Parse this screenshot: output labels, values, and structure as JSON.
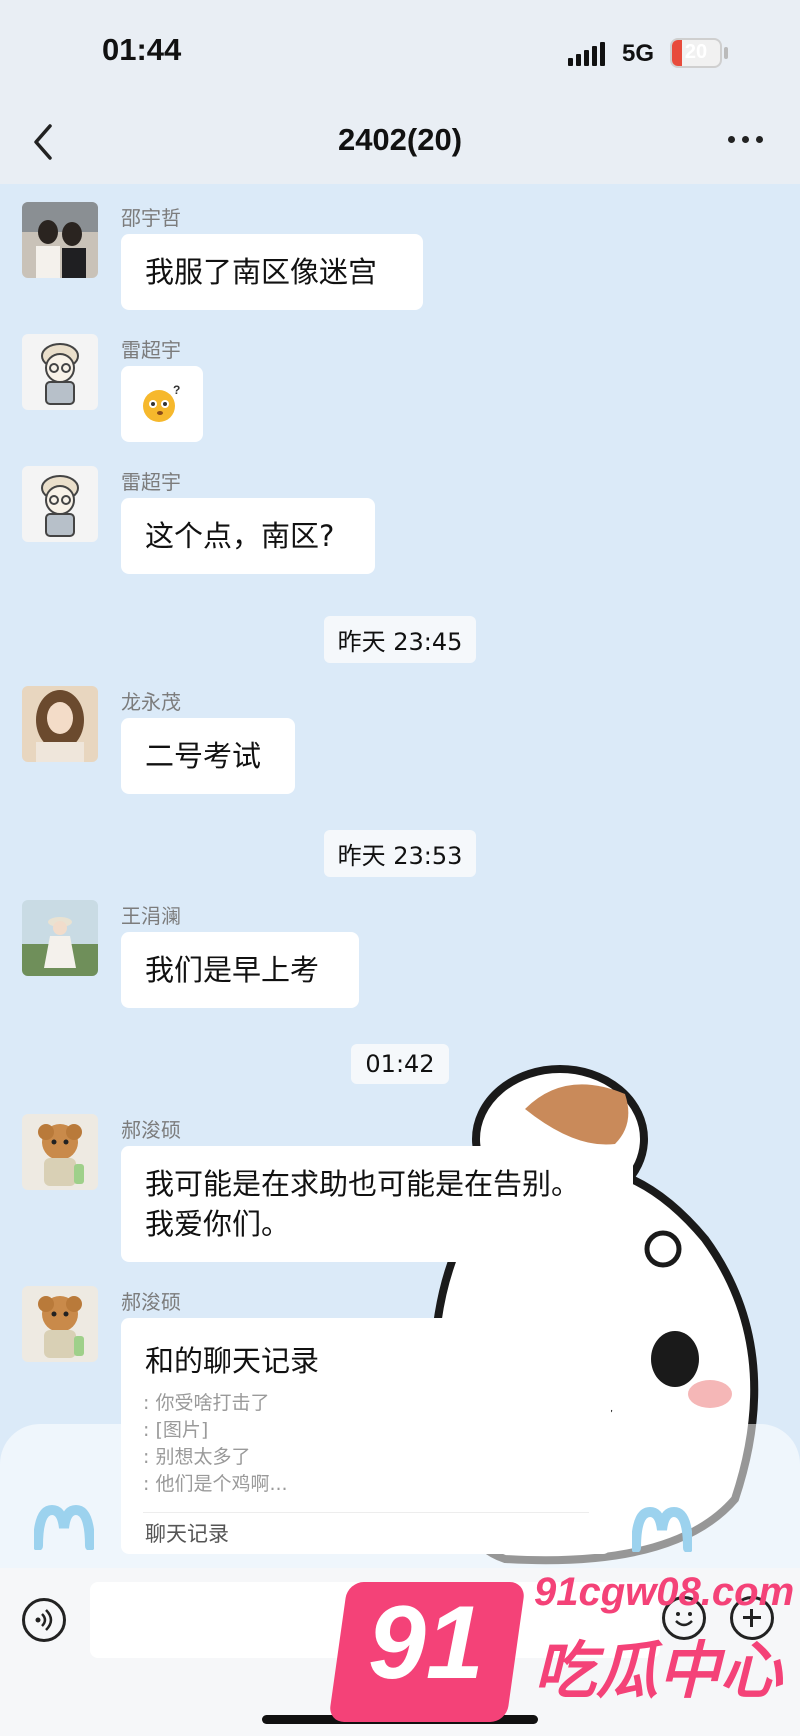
{
  "status_bar": {
    "time": "01:44",
    "network": "5G",
    "battery": "20",
    "battery_level": 0.2
  },
  "nav": {
    "title": "2402(20)"
  },
  "messages": [
    {
      "sender": "邵宇哲",
      "text": "我服了南区像迷宫"
    },
    {
      "sender": "雷超宇",
      "text": ""
    },
    {
      "sender": "雷超宇",
      "text": "这个点，南区?"
    },
    {
      "sender": "龙永茂",
      "text": "二号考试"
    },
    {
      "sender": "王涓澜",
      "text": "我们是早上考"
    },
    {
      "sender": "郝浚硕",
      "text_line1": "我可能是在求助也可能是在告别。",
      "text_line2": "我爱你们。"
    },
    {
      "sender": "郝浚硕",
      "card": {
        "title": "和的聊天记录",
        "lines": [
          ": 你受啥打击了",
          ": [图片]",
          ": 别想太多了",
          ": 他们是个鸡啊..."
        ],
        "footer": "聊天记录"
      }
    }
  ],
  "timestamps": [
    "昨天 23:45",
    "昨天 23:53",
    "01:42"
  ],
  "watermark": {
    "number": "91",
    "url": "91cgw08.com",
    "text": "吃瓜中心"
  },
  "colors": {
    "background": "#dbeaf8",
    "accent": "#f44278",
    "battery": "#e84b3b"
  }
}
